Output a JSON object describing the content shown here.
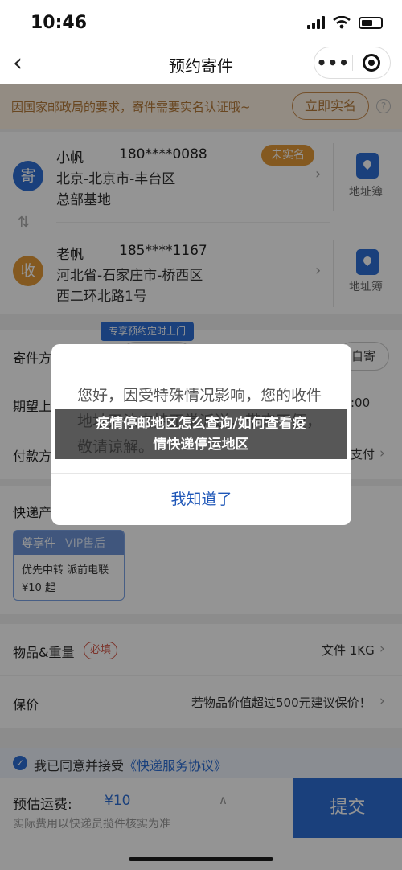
{
  "status_bar": {
    "time": "10:46"
  },
  "nav": {
    "title": "预约寄件",
    "more": "•••"
  },
  "notice": {
    "text": "因国家邮政局的要求，寄件需要实名认证哦~",
    "button": "立即实名",
    "help": "?"
  },
  "sender": {
    "badge": "寄",
    "name": "小帆",
    "phone": "180****0088",
    "line1": "北京-北京市-丰台区",
    "line2": "总部基地",
    "tag": "未实名",
    "book_label": "地址簿"
  },
  "receiver": {
    "badge": "收",
    "name": "老帆",
    "phone": "185****1167",
    "line1": "河北省-石家庄市-桥西区",
    "line2": "西二环北路1号",
    "book_label": "地址簿"
  },
  "options": {
    "method_label": "寄件方",
    "appointment_tag": "专享预约定时上门",
    "self_send": "自寄",
    "time_label": "期望上",
    "time_value": ":00",
    "pay_label": "付款方",
    "pay_value": "支付",
    "product_label": "快递产"
  },
  "product_card": {
    "title": "尊享件",
    "vip": "VIP售后",
    "features": "优先中转  派前电联",
    "price": "¥10  起"
  },
  "goods": {
    "label": "物品&重量",
    "required": "必填",
    "value": "文件 1KG"
  },
  "insurance": {
    "label": "保价",
    "hint": "若物品价值超过500元建议保价！"
  },
  "agreement": {
    "prefix": "我已同意并接受",
    "link": "《快递服务协议》"
  },
  "bottom": {
    "fee_label": "预估运费:",
    "fee_value": "¥10",
    "fee_note": "实际费用以快递员揽件核实为准",
    "submit": "提交"
  },
  "dialog": {
    "message": "您好，因受特殊情况影响，您的收件地址无法支持正常派送，带来不便，敬请谅解。",
    "button": "我知道了"
  },
  "caption": {
    "line1": "疫情停邮地区怎么查询/如何查看疫",
    "line2": "情快递停运地区"
  },
  "colors": {
    "primary": "#2d6fd6",
    "accent_orange": "#e39a37",
    "notice_text": "#b67a3a"
  }
}
